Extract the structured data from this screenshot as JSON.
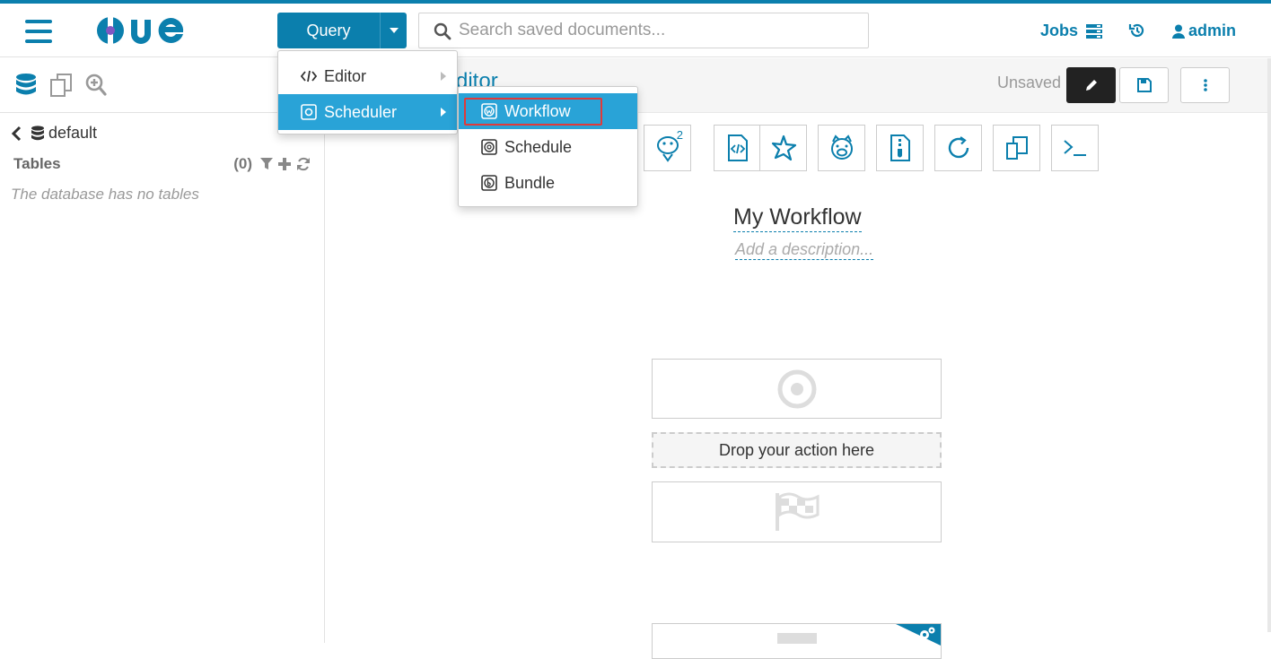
{
  "navbar": {
    "logo_text": "HUE",
    "query_label": "Query",
    "search_placeholder": "Search saved documents...",
    "jobs_label": "Jobs",
    "user_label": "admin"
  },
  "query_menu": {
    "items": [
      {
        "label": "Editor",
        "icon": "code-icon",
        "has_submenu": true,
        "active": false
      },
      {
        "label": "Scheduler",
        "icon": "scheduler-icon",
        "has_submenu": true,
        "active": true
      }
    ]
  },
  "scheduler_menu": {
    "items": [
      {
        "label": "Workflow",
        "icon": "workflow-icon",
        "active": true
      },
      {
        "label": "Schedule",
        "icon": "schedule-icon",
        "active": false
      },
      {
        "label": "Bundle",
        "icon": "bundle-icon",
        "active": false
      }
    ]
  },
  "sidebar": {
    "database": "default",
    "tables_label": "Tables",
    "tables_count": "(0)",
    "empty_message": "The database has no tables"
  },
  "editor": {
    "title_partial": "ditor",
    "status": "Unsaved",
    "workflow_name": "My Workflow",
    "description_placeholder": "Add a description...",
    "drop_zone_label": "Drop your action here",
    "hive2_superscript": "2"
  },
  "colors": {
    "brand": "#0b7fad",
    "menu_active": "#29a3d7",
    "highlight": "#e03a3a"
  }
}
